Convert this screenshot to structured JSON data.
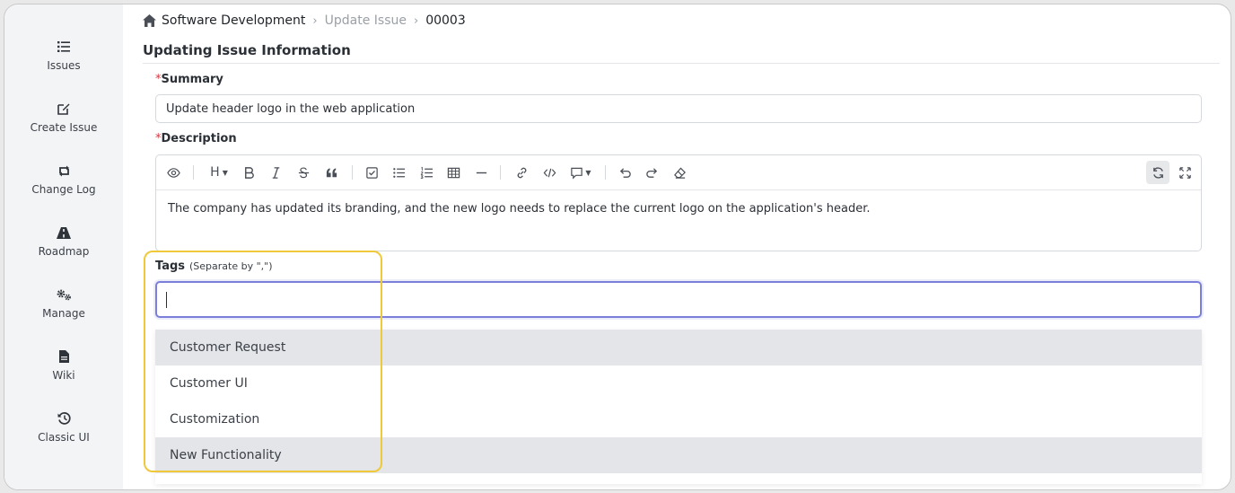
{
  "sidebar": {
    "items": [
      {
        "label": "Issues",
        "icon": "list-icon"
      },
      {
        "label": "Create Issue",
        "icon": "edit-icon"
      },
      {
        "label": "Change Log",
        "icon": "loop-arrows-icon"
      },
      {
        "label": "Roadmap",
        "icon": "road-icon"
      },
      {
        "label": "Manage",
        "icon": "gears-icon"
      },
      {
        "label": "Wiki",
        "icon": "document-icon"
      },
      {
        "label": "Classic UI",
        "icon": "history-icon"
      }
    ]
  },
  "breadcrumb": {
    "project": "Software Development",
    "section": "Update Issue",
    "issue_id": "00003"
  },
  "page_title": "Updating Issue Information",
  "form": {
    "summary": {
      "required_mark": "*",
      "label": "Summary",
      "value": "Update header logo in the web application"
    },
    "description": {
      "required_mark": "*",
      "label": "Description",
      "text": "The company has updated its branding, and the new logo needs to replace the current logo on the application's header."
    },
    "tags": {
      "label": "Tags",
      "hint": "(Separate by \",\")",
      "value": ""
    }
  },
  "toolbar": {
    "heading_label": "H"
  },
  "tag_suggestions": [
    {
      "label": "Customer Request",
      "highlighted": true
    },
    {
      "label": "Customer UI",
      "highlighted": false
    },
    {
      "label": "Customization",
      "highlighted": false
    },
    {
      "label": "New Functionality",
      "highlighted": true
    }
  ],
  "colors": {
    "sidebar_bg": "#f3f4f6",
    "focus_border": "#7b7fd9",
    "annotation_highlight": "#f0c93a",
    "required": "#d9363e"
  }
}
